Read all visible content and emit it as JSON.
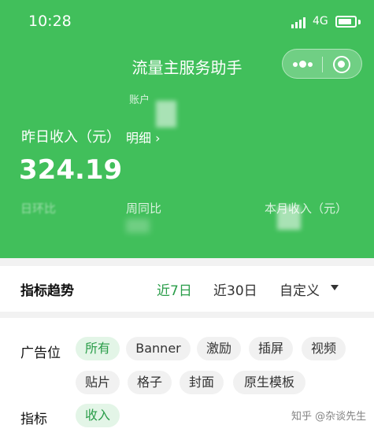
{
  "status_bar": {
    "time": "10:28",
    "network": "4G"
  },
  "app": {
    "title": "流量主服务助手"
  },
  "summary": {
    "account_label": "账户",
    "income_label": "昨日收入（元）",
    "detail_link": "明细 ›",
    "income_value": "324.19",
    "day_over_day": "日环比",
    "week_over_week": "周同比",
    "monthly_income": "本月收入（元）"
  },
  "trend": {
    "title": "指标趋势",
    "ranges": [
      "近7日",
      "近30日",
      "自定义"
    ],
    "active_range": "近7日"
  },
  "filters": {
    "ad_slot_label": "广告位",
    "ad_slots": [
      "所有",
      "Banner",
      "激励",
      "插屏",
      "视频",
      "贴片",
      "格子",
      "封面",
      "原生模板"
    ],
    "metric_label": "指标",
    "metrics": [
      "收入"
    ]
  },
  "watermark": "知乎 @杂谈先生"
}
